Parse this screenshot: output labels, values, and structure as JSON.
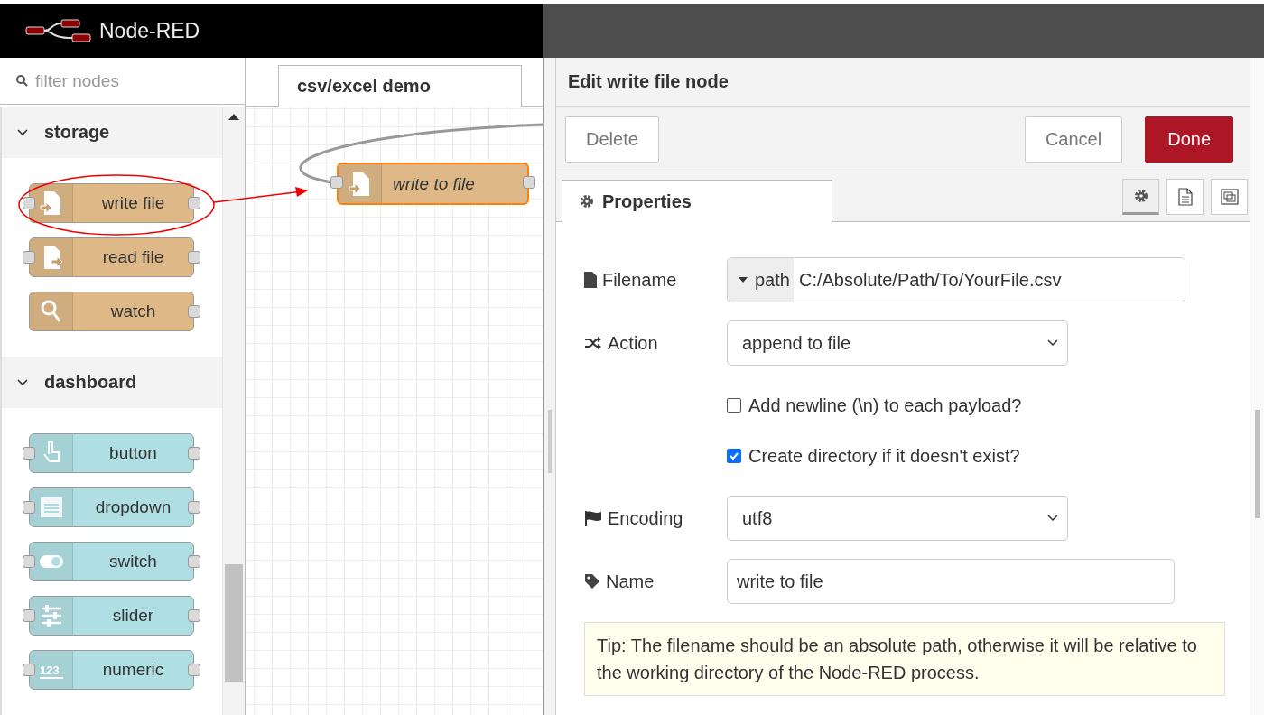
{
  "header": {
    "title": "Node-RED"
  },
  "palette": {
    "filter_placeholder": "filter nodes",
    "categories": [
      {
        "name": "storage",
        "expanded": true,
        "nodes": [
          {
            "label": "write file",
            "kind": "file-write",
            "color": "#deb887",
            "input": true,
            "output": true,
            "highlighted": true
          },
          {
            "label": "read file",
            "kind": "file-read",
            "color": "#deb887",
            "input": true,
            "output": true,
            "highlighted": false
          },
          {
            "label": "watch",
            "kind": "magnifier",
            "color": "#deb887",
            "input": false,
            "output": true,
            "highlighted": false
          }
        ]
      },
      {
        "name": "dashboard",
        "expanded": true,
        "nodes": [
          {
            "label": "button",
            "kind": "hand",
            "color": "#b0dfe3",
            "input": true,
            "output": true,
            "highlighted": false
          },
          {
            "label": "dropdown",
            "kind": "list",
            "color": "#b0dfe3",
            "input": true,
            "output": true,
            "highlighted": false
          },
          {
            "label": "switch",
            "kind": "toggle",
            "color": "#b0dfe3",
            "input": true,
            "output": true,
            "highlighted": false
          },
          {
            "label": "slider",
            "kind": "sliders",
            "color": "#b0dfe3",
            "input": true,
            "output": true,
            "highlighted": false
          },
          {
            "label": "numeric",
            "kind": "numbers",
            "icon_text": "123",
            "color": "#b0dfe3",
            "input": true,
            "output": true,
            "highlighted": false
          }
        ]
      }
    ]
  },
  "workspace": {
    "tabs": [
      {
        "label": "csv/excel demo",
        "selected": true
      }
    ],
    "nodes": [
      {
        "label": "write to file",
        "selected": true
      }
    ]
  },
  "editor": {
    "title": "Edit write file node",
    "buttons": [
      {
        "label": "Delete",
        "kind": "plain"
      },
      {
        "label": "Cancel",
        "kind": "plain"
      },
      {
        "label": "Done",
        "kind": "primary"
      }
    ],
    "tabs": [
      {
        "label": "Properties",
        "selected": true
      }
    ],
    "side_tabs": [
      {
        "kind": "gear",
        "selected": true
      },
      {
        "kind": "document",
        "selected": false
      },
      {
        "kind": "frame",
        "selected": false
      }
    ],
    "fields": [
      {
        "kind": "typed",
        "label": "Filename",
        "type": "path",
        "value": "C:/Absolute/Path/To/YourFile.csv"
      },
      {
        "kind": "select",
        "label": "Action",
        "value": "append to file"
      },
      {
        "kind": "checkbox",
        "label": "Add newline (\\n) to each payload?",
        "checked": false
      },
      {
        "kind": "checkbox",
        "label": "Create directory if it doesn't exist?",
        "checked": true
      },
      {
        "kind": "select",
        "label": "Encoding",
        "value": "utf8"
      },
      {
        "kind": "text",
        "label": "Name",
        "value": "write to file"
      }
    ],
    "tip": "Tip: The filename should be an absolute path, otherwise it will be relative to the working directory of the Node-RED process."
  }
}
